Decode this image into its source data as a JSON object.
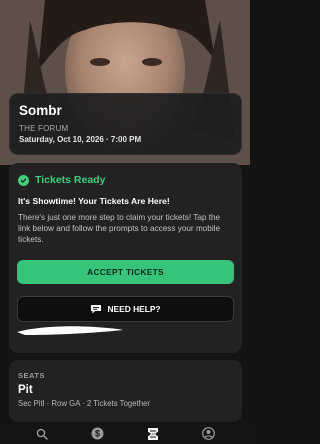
{
  "event": {
    "title": "Sombr",
    "venue": "THE FORUM",
    "datetime": "Saturday, Oct 10, 2026 · 7:00 PM"
  },
  "ready": {
    "title": "Tickets Ready",
    "subtitle": "It's Showtime! Your Tickets Are Here!",
    "body": "There's just one more step to claim your tickets! Tap the link below and follow the prompts to access your mobile tickets.",
    "accept_label": "ACCEPT TICKETS",
    "help_label": "NEED HELP?"
  },
  "seats": {
    "label": "SEATS",
    "section": "Pit",
    "detail": "Sec Pitl · Row GA · 2 Tickets Together"
  },
  "nav": {
    "items": [
      "search-icon",
      "dollar-icon",
      "ticket-icon",
      "account-icon"
    ],
    "active": "ticket-icon"
  },
  "colors": {
    "accent": "#35c479",
    "card": "#222222",
    "background": "#131313"
  }
}
